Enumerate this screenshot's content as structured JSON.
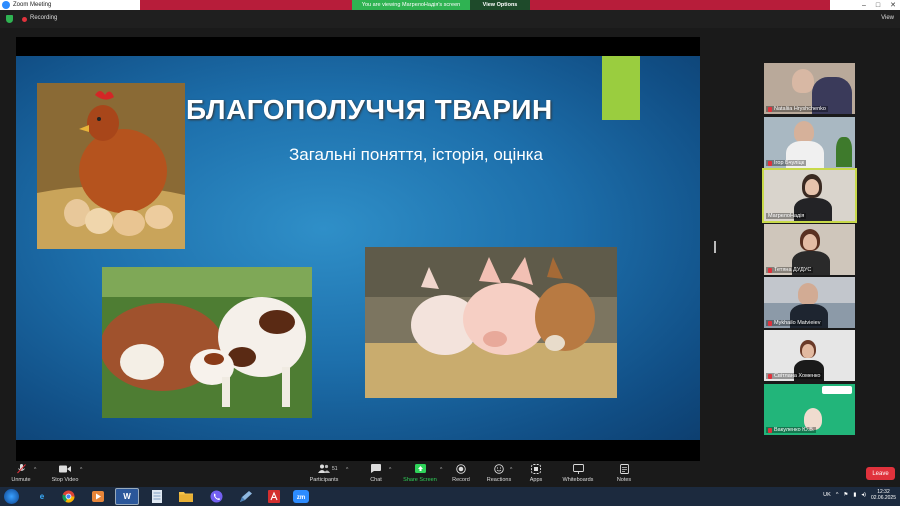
{
  "window": {
    "title": "Zoom Meeting",
    "share_banner": "You are viewing МагрелоНадія's screen",
    "view_options": "View Options"
  },
  "recording": {
    "label": "Recording",
    "view_label": "View"
  },
  "slide": {
    "title": "БЛАГОПОЛУЧЧЯ ТВАРИН",
    "subtitle": "Загальні поняття, історія, оцінка"
  },
  "participants_gallery": [
    {
      "name": "Nataliia Hryshchenko",
      "muted": true
    },
    {
      "name": "Ігор Бчуліцк",
      "muted": true
    },
    {
      "name": "МагрелоНадія",
      "muted": false,
      "active_speaker": true
    },
    {
      "name": "Тетяна ДУДУС",
      "muted": true
    },
    {
      "name": "Mykhailo Matvieiev",
      "muted": true
    },
    {
      "name": "Світлана Хоменко",
      "muted": true
    },
    {
      "name": "Вакуленко Ю.В.",
      "muted": true
    }
  ],
  "toolbar": {
    "unmute": "Unmute",
    "stop_video": "Stop Video",
    "participants": "Participants",
    "participants_count": "51",
    "chat": "Chat",
    "share_screen": "Share Screen",
    "record": "Record",
    "reactions": "Reactions",
    "apps": "Apps",
    "whiteboards": "Whiteboards",
    "notes": "Notes",
    "leave": "Leave"
  },
  "taskbar": {
    "language": "UK",
    "time": "12:32",
    "date": "02.06.2025",
    "apps": [
      "start-icon",
      "ie-icon",
      "chrome-icon",
      "media-player-icon",
      "word-icon",
      "notepad-icon",
      "explorer-icon",
      "viber-icon",
      "pen-icon",
      "acrobat-icon",
      "zoom-icon"
    ]
  },
  "colors": {
    "share_banner": "#2fb352",
    "leave": "#e0323c",
    "slide_accent": "#9acd3f",
    "slide_bg": "#1d6fab"
  }
}
